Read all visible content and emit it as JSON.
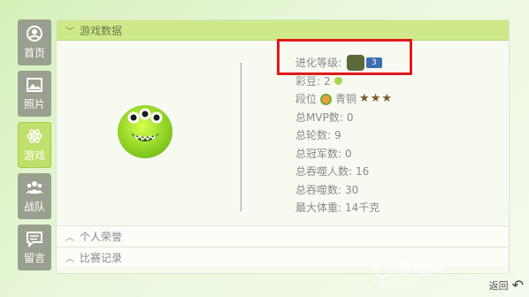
{
  "sidebar": {
    "items": [
      {
        "label": "首页",
        "icon": "user-circle-icon"
      },
      {
        "label": "照片",
        "icon": "photo-icon"
      },
      {
        "label": "游戏",
        "icon": "atom-icon"
      },
      {
        "label": "战队",
        "icon": "team-icon"
      },
      {
        "label": "留言",
        "icon": "chat-icon"
      }
    ],
    "active_index": 2
  },
  "game_data": {
    "header": "游戏数据",
    "evolution_label": "进化等级:",
    "evolution_level": "3",
    "beans_label": "彩豆:",
    "beans_value": "2",
    "rank_label": "段位",
    "rank_value": "青铜",
    "rank_stars": 3,
    "mvp_label": "总MVP数:",
    "mvp_value": "0",
    "rounds_label": "总轮数:",
    "rounds_value": "9",
    "champion_label": "总冠军数:",
    "champion_value": "0",
    "devour_player_label": "总吞噬人数:",
    "devour_player_value": "16",
    "devour_label": "总吞噬数:",
    "devour_value": "30",
    "max_weight_label": "最大体重:",
    "max_weight_value": "14千克"
  },
  "sections": {
    "honor": "个人荣誉",
    "match": "比赛记录"
  },
  "footer": {
    "back_label": "返回",
    "watermark": "游戏网",
    "watermark_url": "Ctext.com"
  },
  "colors": {
    "accent": "#cfe98a",
    "highlight": "#e01a1a",
    "sidebar": "#9aa08f"
  }
}
